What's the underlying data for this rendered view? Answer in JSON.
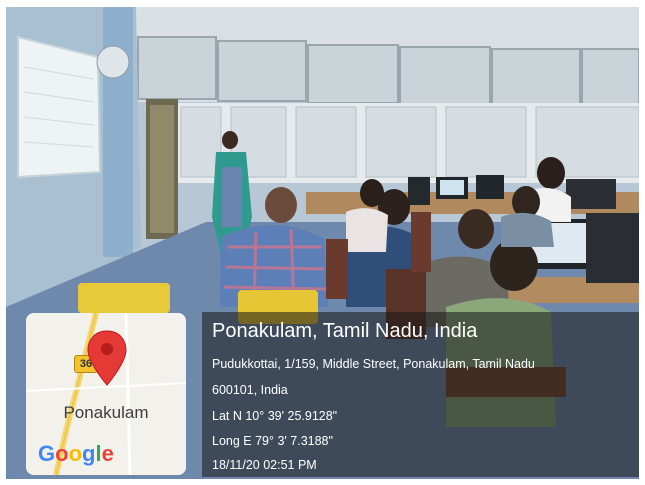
{
  "location": {
    "title": "Ponakulam, Tamil Nadu, India",
    "address_line1": "Pudukkottai, 1/159, Middle Street, Ponakulam, Tamil Nadu",
    "address_line2": "600101, India",
    "latitude": "Lat N 10° 39' 25.9128\"",
    "longitude": "Long E 79° 3' 7.3188\"",
    "datetime": "18/11/20 02:51 PM"
  },
  "map": {
    "place_label": "Ponakulam",
    "route_number": "36",
    "pin_color": "#e53935",
    "road_color": "#f6d66a",
    "logo_letters": [
      {
        "char": "G",
        "color": "#4285F4"
      },
      {
        "char": "o",
        "color": "#EA4335"
      },
      {
        "char": "o",
        "color": "#FBBC05"
      },
      {
        "char": "g",
        "color": "#4285F4"
      },
      {
        "char": "l",
        "color": "#34A853"
      },
      {
        "char": "e",
        "color": "#EA4335"
      }
    ]
  },
  "scene": {
    "description_icon": "computer-lab-photo"
  }
}
